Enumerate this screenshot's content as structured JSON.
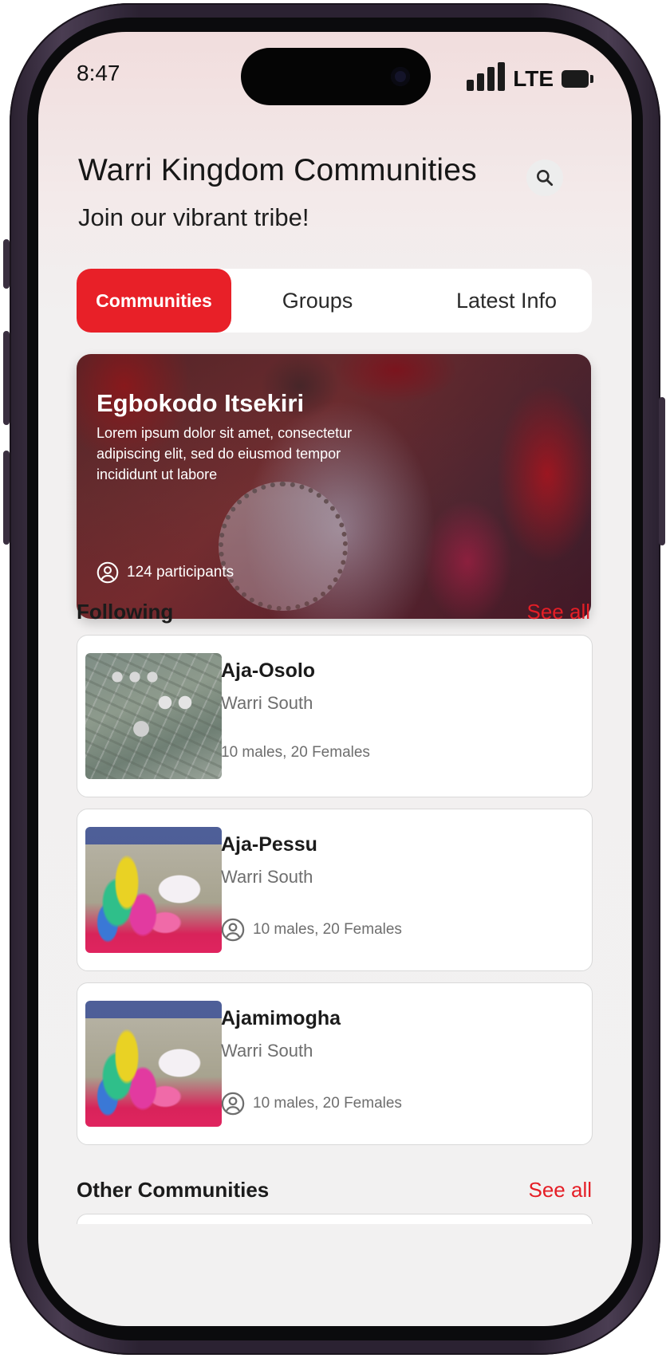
{
  "status_bar": {
    "time": "8:47",
    "network": "LTE"
  },
  "header": {
    "title": "Warri Kingdom Communities",
    "subtitle": "Join our vibrant tribe!"
  },
  "tabs": [
    {
      "label": "Communities",
      "active": true
    },
    {
      "label": "Groups",
      "active": false
    },
    {
      "label": "Latest Info",
      "active": false
    }
  ],
  "featured": {
    "title": "Egbokodo Itsekiri",
    "description": "Lorem ipsum dolor sit amet, consectetur adipiscing elit, sed do eiusmod tempor incididunt ut labore",
    "participants": "124 participants"
  },
  "following": {
    "heading": "Following",
    "see_all": "See all",
    "items": [
      {
        "name": "Aja-Osolo",
        "location": "Warri South",
        "members": "10 males, 20 Females",
        "image": "refinery-photo"
      },
      {
        "name": "Aja-Pessu",
        "location": "Warri South",
        "members": "10 males, 20 Females",
        "image": "dancer-photo"
      },
      {
        "name": "Ajamimogha",
        "location": "Warri South",
        "members": "10 males, 20 Females",
        "image": "dancer-photo"
      }
    ]
  },
  "other": {
    "heading": "Other Communities",
    "see_all": "See all"
  },
  "colors": {
    "accent": "#e82028",
    "link": "#e51e26",
    "text_primary": "#1b1b1b",
    "text_secondary": "#6e6e6e"
  },
  "icons": {
    "search": "search-icon",
    "person": "person-circle-icon"
  }
}
